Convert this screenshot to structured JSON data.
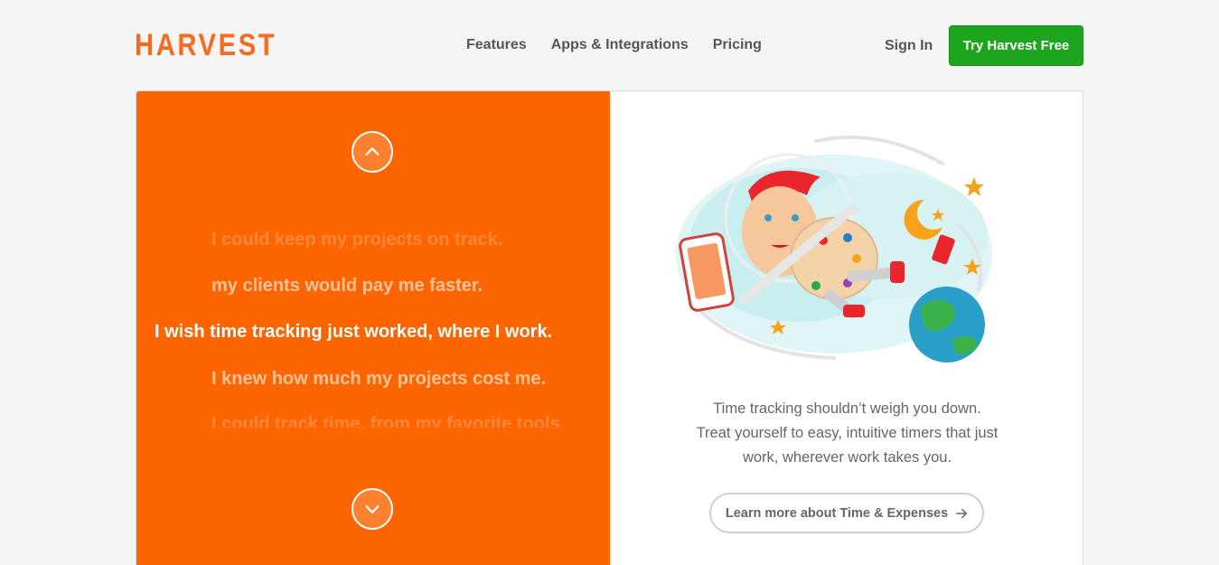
{
  "brand": {
    "logo_text": "HARVEST",
    "accent": "#fd6500",
    "green": "#1ea51e"
  },
  "nav": {
    "items": [
      {
        "label": "Features"
      },
      {
        "label": "Apps & Integrations"
      },
      {
        "label": "Pricing"
      }
    ],
    "sign_in": "Sign In",
    "cta": "Try Harvest Free"
  },
  "carousel": {
    "phrases": {
      "top_faint": "I could keep my projects on track.",
      "above": "my clients would pay me faster.",
      "active": "I wish time tracking just worked, where I work.",
      "below": "I knew how much my projects cost me.",
      "bottom_faint": "I could track time, from my favorite tools."
    },
    "up_icon": "chevron-up-icon",
    "down_icon": "chevron-down-icon"
  },
  "feature": {
    "description_lines": [
      "Time tracking shouldn’t weigh you down.",
      "Treat yourself to easy, intuitive timers that just",
      "work, wherever work takes you."
    ],
    "learn_more": "Learn more about Time & Expenses",
    "arrow_icon": "arrow-right-icon"
  }
}
